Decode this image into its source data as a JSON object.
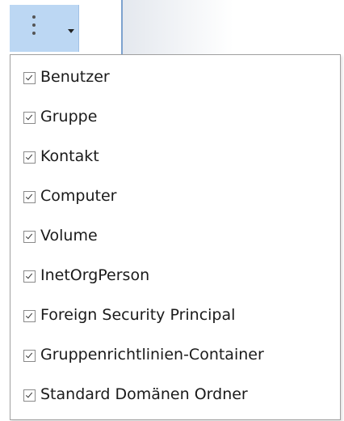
{
  "toolbar": {
    "more_button_icon": "kebab-icon",
    "dropdown_icon": "chevron-down-icon"
  },
  "menu": {
    "items": [
      {
        "label": "Benutzer",
        "checked": true
      },
      {
        "label": "Gruppe",
        "checked": true
      },
      {
        "label": "Kontakt",
        "checked": true
      },
      {
        "label": "Computer",
        "checked": true
      },
      {
        "label": "Volume",
        "checked": true
      },
      {
        "label": "InetOrgPerson",
        "checked": true
      },
      {
        "label": "Foreign Security Principal",
        "checked": true
      },
      {
        "label": "Gruppenrichtlinien-Container",
        "checked": true
      },
      {
        "label": "Standard Domänen Ordner",
        "checked": true
      }
    ]
  }
}
